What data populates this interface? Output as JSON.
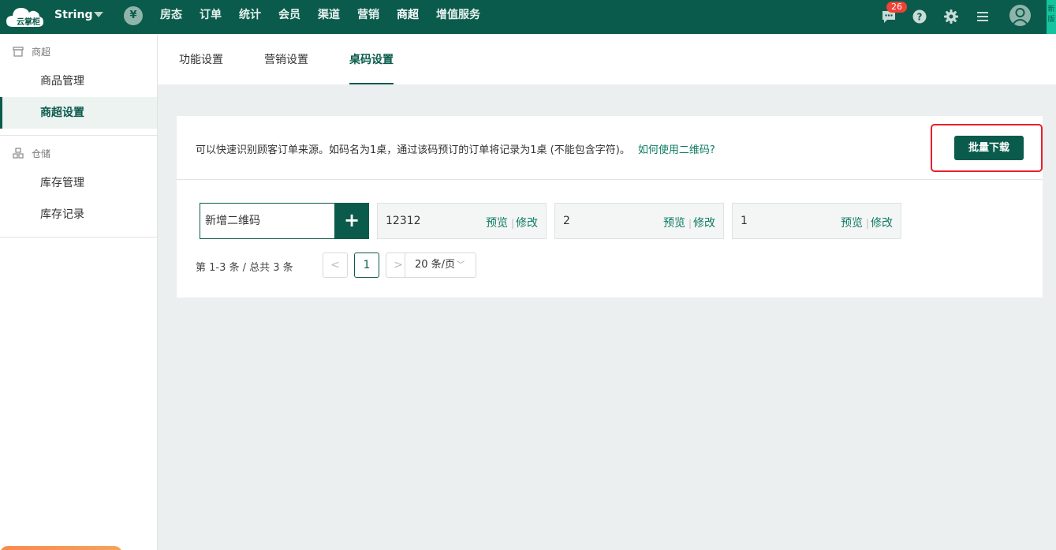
{
  "topbar": {
    "logo_text": "云掌柜",
    "store_name": "String",
    "nav": [
      "房态",
      "订单",
      "统计",
      "会员",
      "渠道",
      "营销",
      "商超",
      "增值服务"
    ],
    "active_nav": "商超",
    "message_count": "26",
    "side_strip_text": "新版",
    "colors": {
      "primary": "#0b5b4c",
      "badge": "#f04134"
    }
  },
  "sidebar": {
    "groups": [
      {
        "label": "商超",
        "items": [
          "商品管理",
          "商超设置"
        ]
      },
      {
        "label": "仓储",
        "items": [
          "库存管理",
          "库存记录"
        ]
      }
    ],
    "active_item": "商超设置"
  },
  "tabs": [
    "功能设置",
    "营销设置",
    "桌码设置"
  ],
  "active_tab": "桌码设置",
  "qr": {
    "hint": "可以快速识别顾客订单来源。如码名为1桌，通过该码预订的订单将记录为1桌 (不能包含字符)。",
    "help_link": "如何使用二维码?",
    "batch_download": "批量下载",
    "new_placeholder": "新增二维码",
    "add_symbol": "+",
    "items": [
      {
        "name": "12312",
        "preview": "预览",
        "edit": "修改"
      },
      {
        "name": "2",
        "preview": "预览",
        "edit": "修改"
      },
      {
        "name": "1",
        "preview": "预览",
        "edit": "修改"
      }
    ],
    "separator": "|"
  },
  "pagination": {
    "total_text": "第 1-3 条 / 总共 3 条",
    "prev": "<",
    "current_page": "1",
    "next": ">",
    "page_size": "20 条/页"
  }
}
